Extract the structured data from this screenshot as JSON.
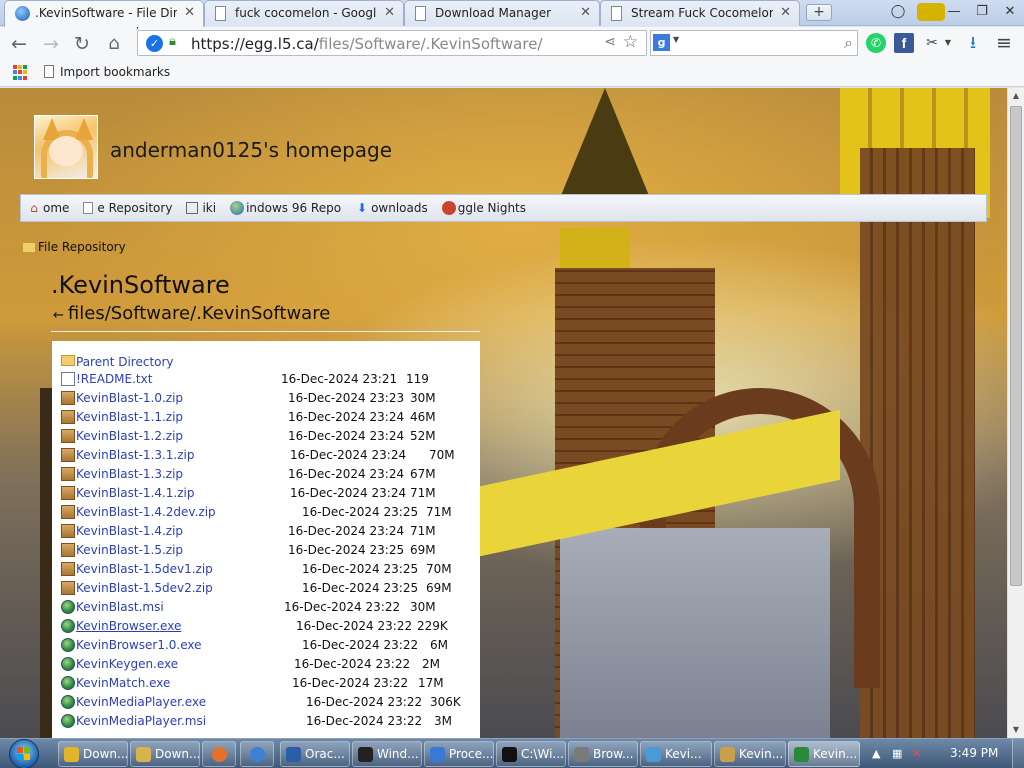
{
  "browser": {
    "tabs": [
      {
        "label": ".KevinSoftware - File Directo",
        "active": true
      },
      {
        "label": "fuck cocomelon - Google",
        "active": false
      },
      {
        "label": "Download Manager",
        "active": false
      },
      {
        "label": "Stream Fuck Cocomelon F",
        "active": false
      }
    ],
    "new_tab_label": "+",
    "window_controls": [
      "minimize",
      "restore",
      "close"
    ],
    "url_host": "https://egg.l5.ca/",
    "url_path": "files/Software/.KevinSoftware/",
    "search_engine_icon": "google-g",
    "bookmarks": [
      {
        "label": "Import bookmarks"
      }
    ]
  },
  "page": {
    "site_title": "anderman0125's homepage",
    "nav": [
      {
        "label": "ome",
        "icon": "home-icon"
      },
      {
        "label": "e Repository",
        "icon": "file-icon"
      },
      {
        "label": "iki",
        "icon": "book-icon"
      },
      {
        "label": "indows 96 Repo",
        "icon": "globe-icon"
      },
      {
        "label": "ownloads",
        "icon": "download-icon"
      },
      {
        "label": "ggle Nights",
        "icon": "egg-icon"
      }
    ],
    "breadcrumb": "File Repository",
    "dir_title": ".KevinSoftware",
    "dir_path": "files/Software/.KevinSoftware",
    "parent_label": "Parent Directory",
    "files": [
      {
        "name": "!README.txt",
        "date": "16-Dec-2024 23:21",
        "size": "119",
        "type": "txt",
        "underline": false
      },
      {
        "name": "KevinBlast-1.0.zip",
        "date": "16-Dec-2024 23:23",
        "size": "30M",
        "type": "zip",
        "underline": false
      },
      {
        "name": "KevinBlast-1.1.zip",
        "date": "16-Dec-2024 23:24",
        "size": "46M",
        "type": "zip",
        "underline": false
      },
      {
        "name": "KevinBlast-1.2.zip",
        "date": "16-Dec-2024 23:24",
        "size": "52M",
        "type": "zip",
        "underline": false
      },
      {
        "name": "KevinBlast-1.3.1.zip",
        "date": "16-Dec-2024 23:24",
        "size": "70M",
        "type": "zip",
        "underline": false
      },
      {
        "name": "KevinBlast-1.3.zip",
        "date": "16-Dec-2024 23:24",
        "size": "67M",
        "type": "zip",
        "underline": false
      },
      {
        "name": "KevinBlast-1.4.1.zip",
        "date": "16-Dec-2024 23:24",
        "size": "71M",
        "type": "zip",
        "underline": false
      },
      {
        "name": "KevinBlast-1.4.2dev.zip",
        "date": "16-Dec-2024 23:25",
        "size": "71M",
        "type": "zip",
        "underline": false
      },
      {
        "name": "KevinBlast-1.4.zip",
        "date": "16-Dec-2024 23:24",
        "size": "71M",
        "type": "zip",
        "underline": false
      },
      {
        "name": "KevinBlast-1.5.zip",
        "date": "16-Dec-2024 23:25",
        "size": "69M",
        "type": "zip",
        "underline": false
      },
      {
        "name": "KevinBlast-1.5dev1.zip",
        "date": "16-Dec-2024 23:25",
        "size": "70M",
        "type": "zip",
        "underline": false
      },
      {
        "name": "KevinBlast-1.5dev2.zip",
        "date": "16-Dec-2024 23:25",
        "size": "69M",
        "type": "zip",
        "underline": false
      },
      {
        "name": "KevinBlast.msi",
        "date": "16-Dec-2024 23:22",
        "size": "30M",
        "type": "exe",
        "underline": false
      },
      {
        "name": "KevinBrowser.exe",
        "date": "16-Dec-2024 23:22",
        "size": "229K",
        "type": "exe",
        "underline": true
      },
      {
        "name": "KevinBrowser1.0.exe",
        "date": "16-Dec-2024 23:22",
        "size": "6M",
        "type": "exe",
        "underline": false
      },
      {
        "name": "KevinKeygen.exe",
        "date": "16-Dec-2024 23:22",
        "size": "2M",
        "type": "exe",
        "underline": false
      },
      {
        "name": "KevinMatch.exe",
        "date": "16-Dec-2024 23:22",
        "size": "17M",
        "type": "exe",
        "underline": false
      },
      {
        "name": "KevinMediaPlayer.exe",
        "date": "16-Dec-2024 23:22",
        "size": "306K",
        "type": "exe",
        "underline": false
      },
      {
        "name": "KevinMediaPlayer.msi",
        "date": "16-Dec-2024 23:22",
        "size": "3M",
        "type": "exe",
        "underline": false
      }
    ]
  },
  "taskbar": {
    "items": [
      {
        "label": "Down...",
        "icon": "chrome-icon",
        "color": "#e0b52a"
      },
      {
        "label": "Down...",
        "icon": "folder-icon",
        "color": "#d8b24a"
      },
      {
        "label": "",
        "icon": "firefox-icon",
        "color": "#e8702a"
      },
      {
        "label": "",
        "icon": "chromium-icon",
        "color": "#3b82d6"
      },
      {
        "label": "Orac...",
        "icon": "virtualbox-icon",
        "color": "#2a5fa8"
      },
      {
        "label": "Wind...",
        "icon": "cmd-icon",
        "color": "#222222"
      },
      {
        "label": "Proce...",
        "icon": "process-icon",
        "color": "#3a7ad6"
      },
      {
        "label": "C:\\Wi...",
        "icon": "console-icon",
        "color": "#111111"
      },
      {
        "label": "Brow...",
        "icon": "app-icon",
        "color": "#7a7a7a"
      },
      {
        "label": "Kevi...",
        "icon": "swirl-icon",
        "color": "#4a9ad6"
      },
      {
        "label": "Kevin...",
        "icon": "archive-icon",
        "color": "#c8a24a"
      },
      {
        "label": "Kevin...",
        "icon": "globe-icon",
        "color": "#2a8a3a"
      }
    ],
    "clock": "3:49 PM"
  }
}
